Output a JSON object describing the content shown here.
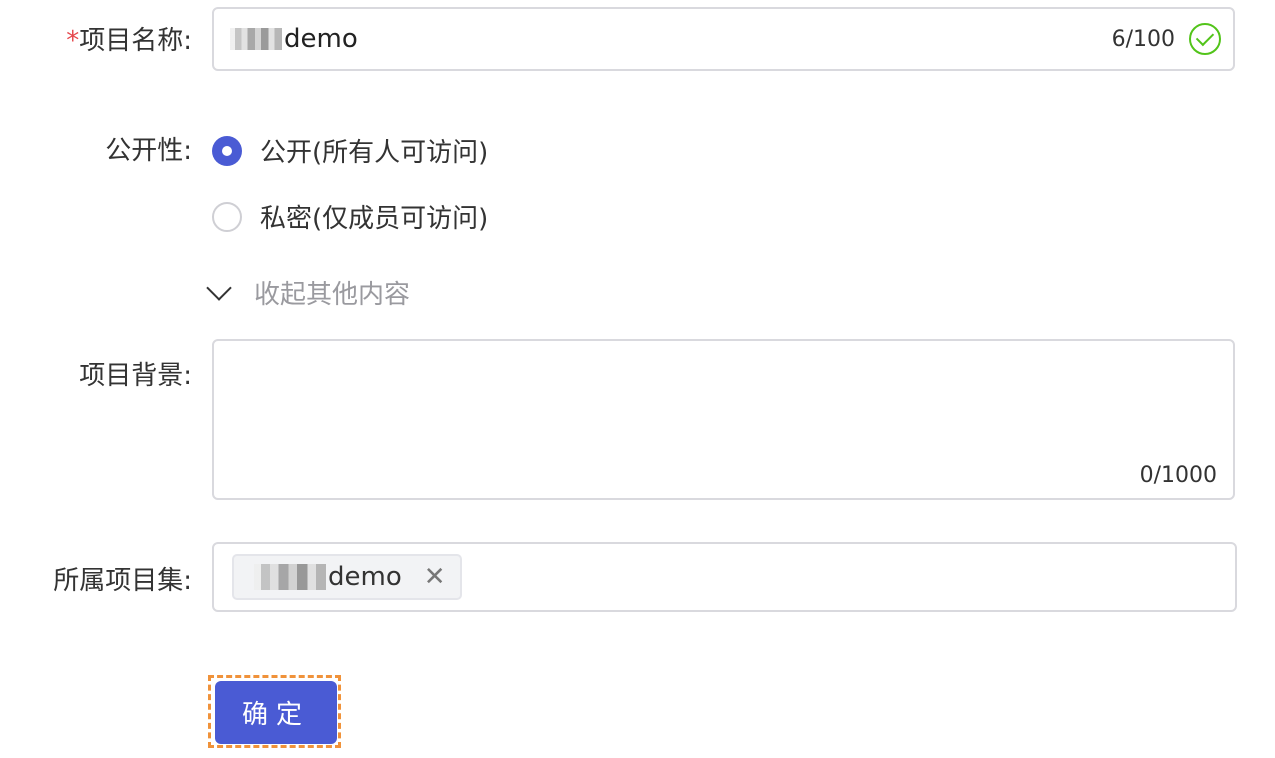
{
  "form": {
    "name_label": "项目名称:",
    "name_required": "*",
    "name_value": "demo",
    "name_count": "6/100",
    "visibility_label": "公开性:",
    "visibility_options": [
      {
        "label": "公开(所有人可访问)",
        "selected": true
      },
      {
        "label": "私密(仅成员可访问)",
        "selected": false
      }
    ],
    "collapse_text": "收起其他内容",
    "background_label": "项目背景:",
    "background_value": "",
    "background_count": "0/1000",
    "set_label": "所属项目集:",
    "set_tag": "demo",
    "confirm_label": "确定"
  },
  "colors": {
    "primary": "#4a5bd4",
    "success": "#52c41a",
    "required": "#e5484d",
    "focus": "#f0923a"
  },
  "icons": [
    "check-circle-icon",
    "chevron-down-icon",
    "close-icon"
  ]
}
